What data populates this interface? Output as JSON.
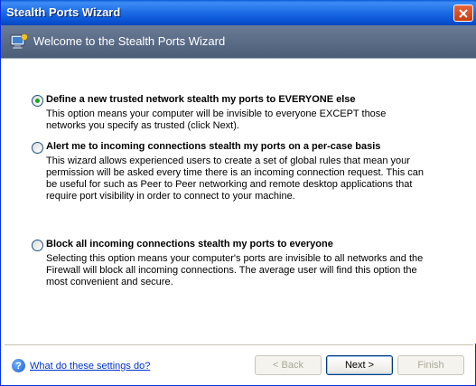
{
  "window": {
    "title": "Stealth Ports Wizard"
  },
  "header": {
    "title": "Welcome to the Stealth Ports Wizard",
    "icon": "wizard-computer-icon"
  },
  "options": [
    {
      "label": "Define a new trusted network  stealth my ports to EVERYONE else",
      "description": "This option means your computer will be invisible to everyone EXCEPT those networks you specify as trusted (click Next).",
      "selected": true
    },
    {
      "label": "Alert me to incoming connections  stealth my ports on a per-case basis",
      "description": "This wizard allows experienced users to create a set of global rules that mean your permission will be asked every time there is an incoming connection request. This can be useful for such as Peer to Peer networking and remote desktop applications that require port visibility in order to connect to your machine.",
      "selected": false
    },
    {
      "label": "Block all incoming connections  stealth my ports to everyone",
      "description": "Selecting this option means your computer's ports are invisible to all networks and the Firewall will block all incoming connections. The average user will find this option the most convenient and secure.",
      "selected": false
    }
  ],
  "footer": {
    "help_label": "What do these settings do?",
    "back_label": "< Back",
    "next_label": "Next >",
    "finish_label": "Finish"
  },
  "colors": {
    "titlebar": "#0a55d6",
    "header": "#5c6d88",
    "radio_dot": "#21a121",
    "link": "#0033cc"
  }
}
